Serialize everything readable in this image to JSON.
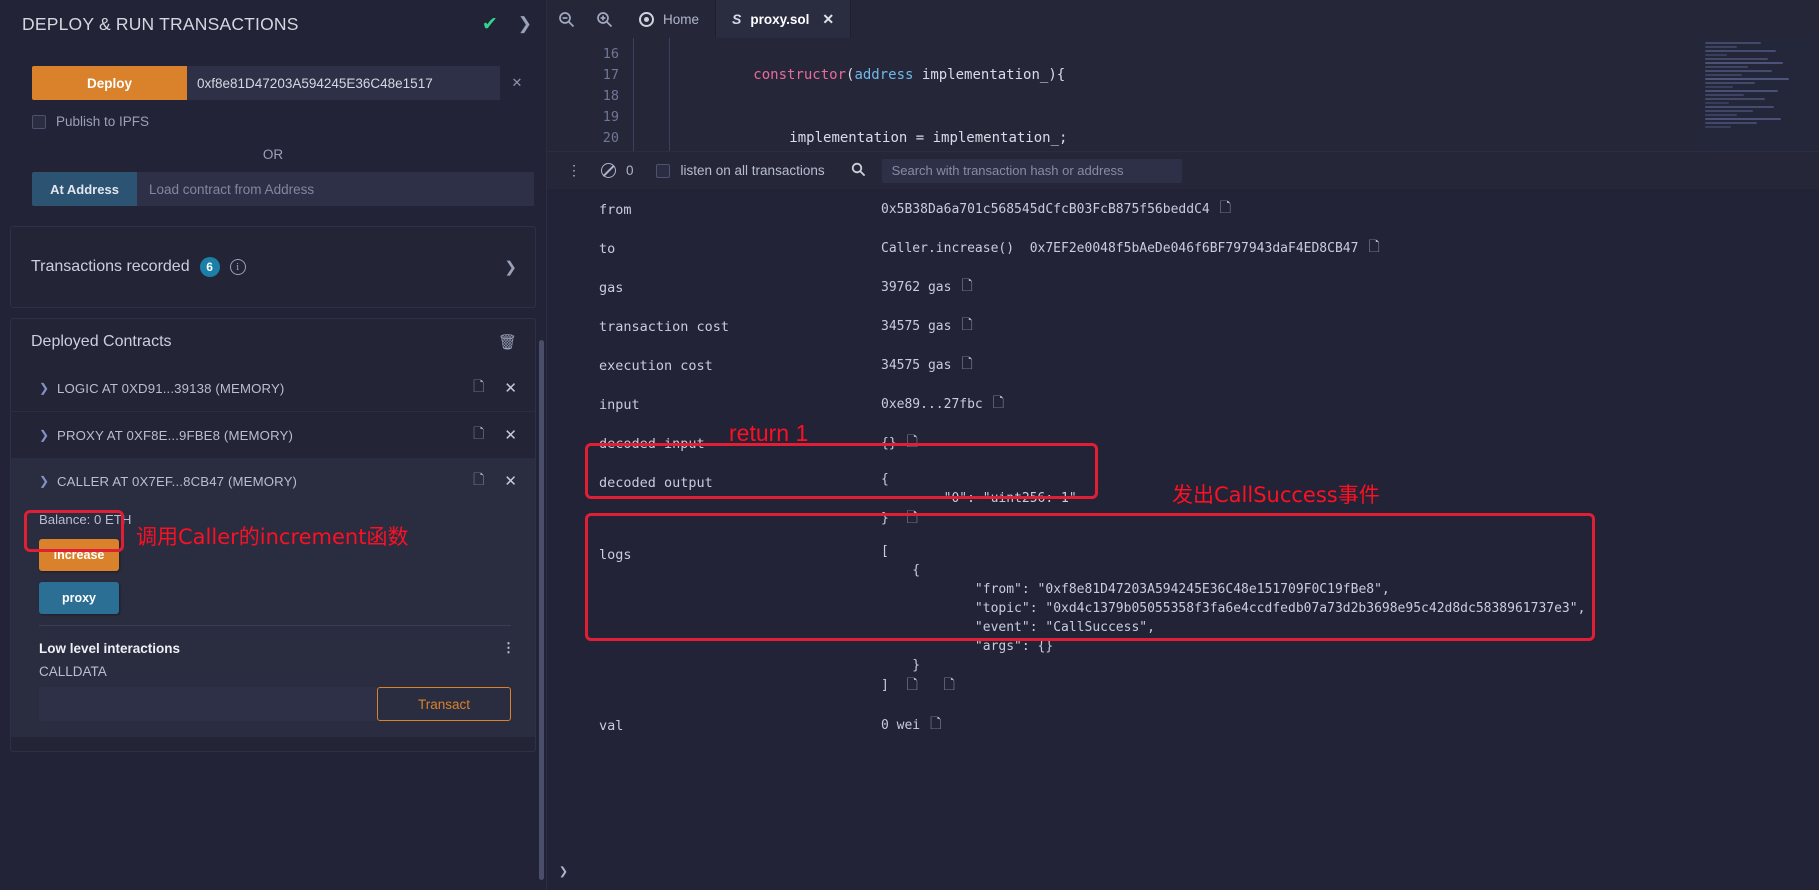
{
  "left_panel": {
    "title": "DEPLOY & RUN TRANSACTIONS",
    "check_icon": "check-icon",
    "expand_icon": "chevron-right-icon",
    "deploy_button": "Deploy",
    "deploy_address_value": "0xf8e81D47203A594245E36C48e1517",
    "deploy_caret_icon": "chevron-down-icon",
    "publish_ipfs_label": "Publish to IPFS",
    "or_label": "OR",
    "at_address_button": "At Address",
    "at_address_placeholder": "Load contract from Address",
    "transactions_recorded_label": "Transactions recorded",
    "transactions_recorded_count": "6",
    "deployed_contracts_label": "Deployed Contracts",
    "trash_icon": "trash-icon",
    "contracts": [
      {
        "name": "LOGIC AT 0XD91...39138 (MEMORY)",
        "expanded": false
      },
      {
        "name": "PROXY AT 0XF8E...9FBE8 (MEMORY)",
        "expanded": false
      },
      {
        "name": "CALLER AT 0X7EF...8CB47 (MEMORY)",
        "expanded": true
      }
    ],
    "balance": "Balance: 0 ETH",
    "functions": [
      {
        "label": "increase",
        "color": "#d9822b"
      },
      {
        "label": "proxy",
        "color": "#2c6f94"
      }
    ],
    "low_level_title": "Low level interactions",
    "calldata_label": "CALLDATA",
    "calldata_value": "",
    "transact_button": "Transact"
  },
  "annotations": [
    {
      "text": "调用Caller的increment函数",
      "lang": "zh"
    },
    {
      "text": "return 1",
      "lang": "en"
    },
    {
      "text": "发出CallSuccess事件",
      "lang": "zh"
    }
  ],
  "tabbar": {
    "zoom_out_icon": "zoom-out-icon",
    "zoom_in_icon": "zoom-in-icon",
    "tabs": [
      {
        "label": "Home",
        "icon": "remix-logo-icon",
        "active": false,
        "closable": false
      },
      {
        "label": "proxy.sol",
        "icon": "solidity-icon",
        "active": true,
        "closable": true
      }
    ]
  },
  "editor": {
    "lines": [
      {
        "num": "16",
        "text": "constructor(address implementation_){"
      },
      {
        "num": "17",
        "text": "    implementation = implementation_;"
      },
      {
        "num": "18",
        "text": "}"
      },
      {
        "num": "19",
        "text": ""
      },
      {
        "num": "20",
        "text": "/**"
      }
    ]
  },
  "terminal_bar": {
    "collapse_icon": "chevrons-down-icon",
    "clear_icon": "ban-icon",
    "pending_count": "0",
    "listen_label": "listen on all transactions",
    "search_icon": "search-icon",
    "search_placeholder": "Search with transaction hash or address"
  },
  "transaction": {
    "rows": [
      {
        "key": "from",
        "value": "0x5B38Da6a701c568545dCfcB03FcB875f56beddC4",
        "copy": true
      },
      {
        "key": "to",
        "value": "Caller.increase()  0x7EF2e0048f5bAeDe046f6BF797943daF4ED8CB47",
        "copy": true
      },
      {
        "key": "gas",
        "value": "39762 gas",
        "copy": true
      },
      {
        "key": "transaction cost",
        "value": "34575 gas",
        "copy": true
      },
      {
        "key": "execution cost",
        "value": "34575 gas",
        "copy": true
      },
      {
        "key": "input",
        "value": "0xe89...27fbc",
        "copy": true
      },
      {
        "key": "decoded input",
        "value": "{}",
        "copy": true
      },
      {
        "key": "decoded output",
        "value": "{\n\t\t\"0\": \"uint256: 1\"\n}",
        "copy": true,
        "highlighted": true
      },
      {
        "key": "logs",
        "value": "[\n\t{\n\t\t\t\"from\": \"0xf8e81D47203A594245E36C48e151709F0C19fBe8\",\n\t\t\t\"topic\": \"0xd4c1379b05055358f3fa6e4ccdfedb07a73d2b3698e95c42d8dc5838961737e3\",\n\t\t\t\"event\": \"CallSuccess\",\n\t\t\t\"args\": {}\n\t}\n]",
        "copy": true,
        "highlighted": true
      },
      {
        "key": "val",
        "value": "0 wei",
        "copy": true
      }
    ],
    "logs_detail": {
      "from": "0xf8e81D47203A594245E36C48e151709F0C19fBe8",
      "topic": "0xd4c1379b05055358f3fa6e4ccdfedb07a73d2b3698e95c42d8dc5838961737e3",
      "event": "CallSuccess",
      "args": "{}"
    },
    "decoded_output_detail": {
      "key": "\"0\"",
      "value": "\"uint256: 1\""
    },
    "bottom_expand_icon": "chevron-right-icon"
  },
  "colors": {
    "accent_orange": "#d9822b",
    "accent_blue": "#2c6f94",
    "annotation_red": "#fb1123",
    "success_green": "#32d58c",
    "badge_blue": "#1b7fa8"
  }
}
